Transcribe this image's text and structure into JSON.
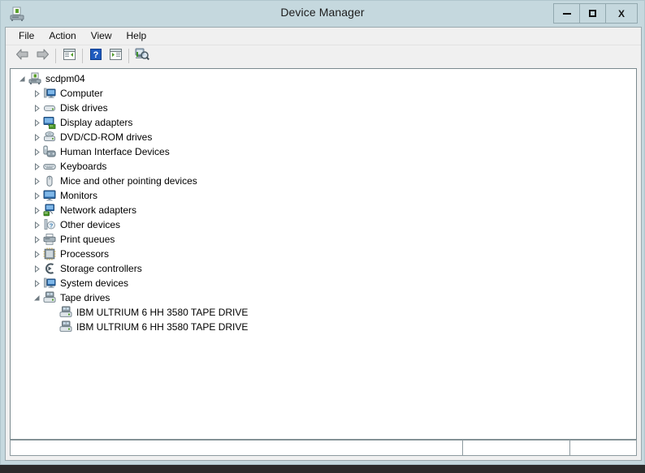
{
  "window": {
    "title": "Device Manager",
    "app_icon": "device-manager-icon",
    "controls": {
      "minimize": "–",
      "maximize": "□",
      "close": "X"
    }
  },
  "menubar": {
    "items": [
      {
        "label": "File"
      },
      {
        "label": "Action"
      },
      {
        "label": "View"
      },
      {
        "label": "Help"
      }
    ]
  },
  "toolbar": {
    "buttons": [
      {
        "name": "back-button",
        "icon": "back-arrow-icon",
        "title": "Back"
      },
      {
        "name": "forward-button",
        "icon": "forward-arrow-icon",
        "title": "Forward"
      },
      {
        "name": "show-hide-console-tree-button",
        "icon": "console-tree-icon",
        "title": "Show/Hide Console Tree"
      },
      {
        "name": "help-button",
        "icon": "help-question-icon",
        "title": "Help"
      },
      {
        "name": "properties-button",
        "icon": "properties-icon",
        "title": "Properties"
      },
      {
        "name": "scan-hardware-changes-button",
        "icon": "scan-hardware-icon",
        "title": "Scan for hardware changes"
      }
    ]
  },
  "tree": {
    "root": {
      "label": "scdpm04",
      "icon": "computer-node-icon",
      "expanded": true
    },
    "items": [
      {
        "label": "Computer",
        "icon": "computer-icon",
        "expanded": false,
        "level": 1
      },
      {
        "label": "Disk drives",
        "icon": "disk-drive-icon",
        "expanded": false,
        "level": 1
      },
      {
        "label": "Display adapters",
        "icon": "display-adapter-icon",
        "expanded": false,
        "level": 1
      },
      {
        "label": "DVD/CD-ROM drives",
        "icon": "dvd-drive-icon",
        "expanded": false,
        "level": 1
      },
      {
        "label": "Human Interface Devices",
        "icon": "hid-icon",
        "expanded": false,
        "level": 1
      },
      {
        "label": "Keyboards",
        "icon": "keyboard-icon",
        "expanded": false,
        "level": 1
      },
      {
        "label": "Mice and other pointing devices",
        "icon": "mouse-icon",
        "expanded": false,
        "level": 1
      },
      {
        "label": "Monitors",
        "icon": "monitor-icon",
        "expanded": false,
        "level": 1
      },
      {
        "label": "Network adapters",
        "icon": "network-adapter-icon",
        "expanded": false,
        "level": 1
      },
      {
        "label": "Other devices",
        "icon": "other-device-icon",
        "expanded": false,
        "level": 1
      },
      {
        "label": "Print queues",
        "icon": "printer-icon",
        "expanded": false,
        "level": 1
      },
      {
        "label": "Processors",
        "icon": "processor-icon",
        "expanded": false,
        "level": 1
      },
      {
        "label": "Storage controllers",
        "icon": "storage-controller-icon",
        "expanded": false,
        "level": 1
      },
      {
        "label": "System devices",
        "icon": "system-device-icon",
        "expanded": false,
        "level": 1
      },
      {
        "label": "Tape drives",
        "icon": "tape-drive-icon",
        "expanded": true,
        "level": 1
      },
      {
        "label": "IBM ULTRIUM 6 HH 3580 TAPE DRIVE",
        "icon": "tape-drive-icon",
        "expanded": null,
        "level": 2
      },
      {
        "label": "IBM ULTRIUM 6 HH 3580 TAPE DRIVE",
        "icon": "tape-drive-icon",
        "expanded": null,
        "level": 2
      }
    ]
  },
  "statusbar": {
    "panes": [
      "",
      "",
      ""
    ]
  },
  "colors": {
    "window_frame": "#c5d8de",
    "client_background": "#f0f0f0",
    "tree_background": "#ffffff",
    "text": "#000000"
  }
}
